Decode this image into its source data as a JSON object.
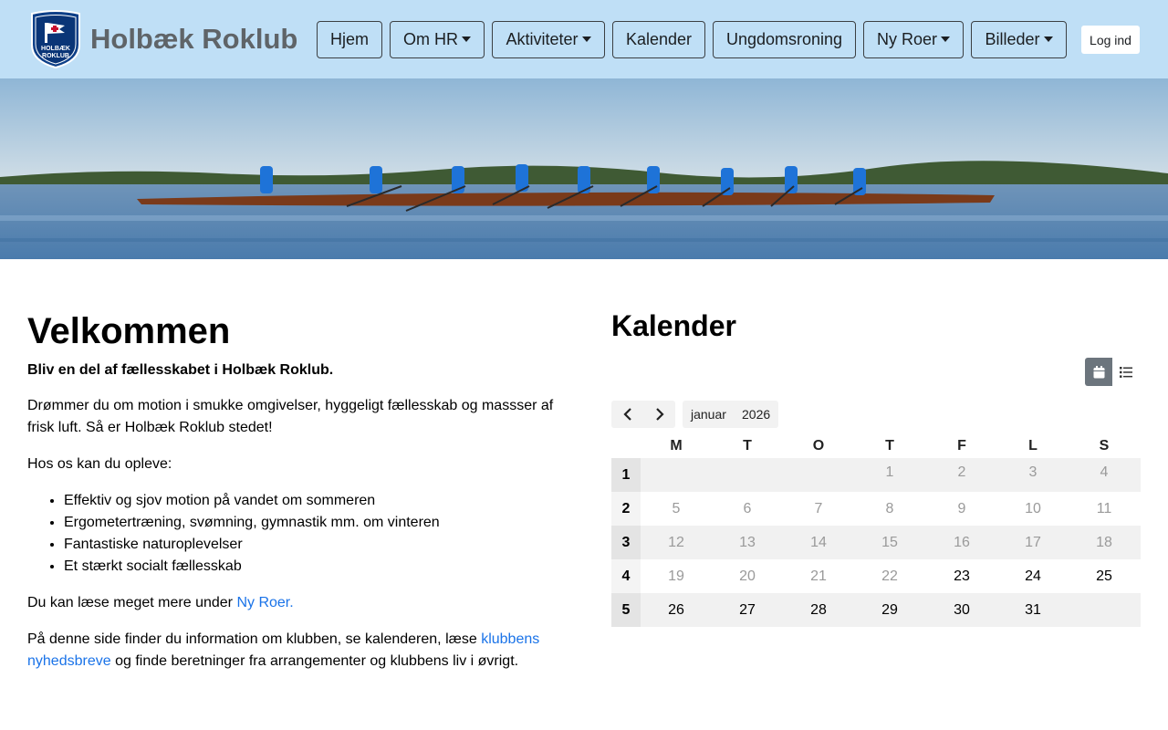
{
  "header": {
    "site_title": "Holbæk Roklub",
    "logo_text_top": "HOLBÆK",
    "logo_text_bottom": "ROKLUB",
    "nav": [
      {
        "label": "Hjem",
        "dropdown": false
      },
      {
        "label": "Om HR",
        "dropdown": true
      },
      {
        "label": "Aktiviteter",
        "dropdown": true
      },
      {
        "label": "Kalender",
        "dropdown": false
      },
      {
        "label": "Ungdomsroning",
        "dropdown": false
      },
      {
        "label": "Ny Roer",
        "dropdown": true
      },
      {
        "label": "Billeder",
        "dropdown": true
      }
    ],
    "login_label": "Log ind",
    "background_color": "#bfdff6"
  },
  "welcome": {
    "title": "Velkommen",
    "intro": "Bliv en del af fællesskabet i Holbæk Roklub.",
    "para1": "Drømmer du om motion i smukke omgivelser, hyggeligt fællesskab og massser af frisk luft. Så er Holbæk Roklub stedet!",
    "para2": "Hos os kan du opleve:",
    "benefits": [
      "Effektiv og sjov motion på vandet om sommeren",
      "Ergometertræning, svømning, gymnastik mm. om vinteren",
      "Fantastiske naturoplevelser",
      "Et stærkt socialt fællesskab"
    ],
    "read_more_prefix": "Du kan læse meget mere under ",
    "read_more_link": "Ny Roer.",
    "info_prefix": "På denne side finder du information om klubben, se kalenderen, læse ",
    "info_link": "klubbens nyhedsbreve",
    "info_suffix": " og finde beretninger fra arrangementer og klubbens liv i øvrigt.",
    "link_color": "#1a73e8"
  },
  "calendar": {
    "title": "Kalender",
    "view_month_icon": "calendar-icon",
    "view_list_icon": "list-icon",
    "month": "januar",
    "year": "2026",
    "weekday_headers": [
      "M",
      "T",
      "O",
      "T",
      "F",
      "L",
      "S"
    ],
    "weeks": [
      {
        "week": "1",
        "days": [
          "",
          "",
          "",
          "1",
          "2",
          "3",
          "4"
        ],
        "muted": [
          true,
          true,
          true,
          true,
          true,
          true,
          true
        ]
      },
      {
        "week": "2",
        "days": [
          "5",
          "6",
          "7",
          "8",
          "9",
          "10",
          "11"
        ],
        "muted": [
          true,
          true,
          true,
          true,
          true,
          true,
          true
        ]
      },
      {
        "week": "3",
        "days": [
          "12",
          "13",
          "14",
          "15",
          "16",
          "17",
          "18"
        ],
        "muted": [
          true,
          true,
          true,
          true,
          true,
          true,
          true
        ]
      },
      {
        "week": "4",
        "days": [
          "19",
          "20",
          "21",
          "22",
          "23",
          "24",
          "25"
        ],
        "muted": [
          true,
          true,
          true,
          true,
          false,
          false,
          false
        ]
      },
      {
        "week": "5",
        "days": [
          "26",
          "27",
          "28",
          "29",
          "30",
          "31",
          ""
        ],
        "muted": [
          false,
          false,
          false,
          false,
          false,
          false,
          false
        ]
      }
    ]
  }
}
